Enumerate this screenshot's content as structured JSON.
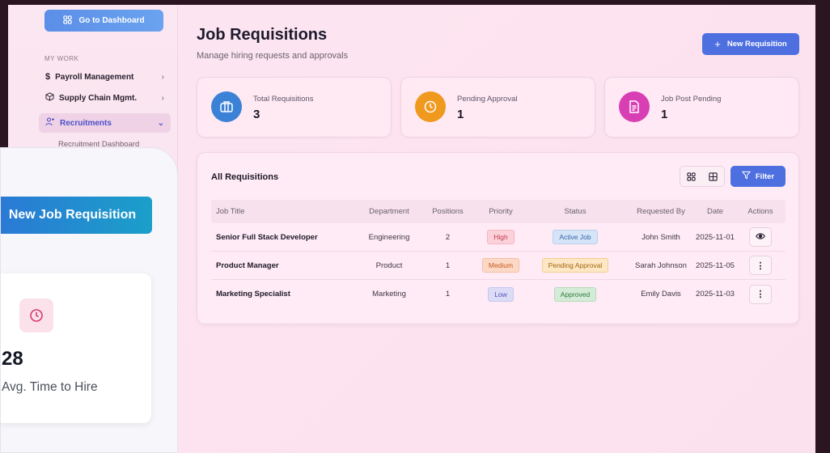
{
  "sidebar": {
    "dashboard_button": "Go to Dashboard",
    "section_label": "MY WORK",
    "items": [
      {
        "label": "Payroll Management",
        "icon": "dollar-icon"
      },
      {
        "label": "Supply Chain Mgmt.",
        "icon": "box-icon"
      },
      {
        "label": "Recruitments",
        "icon": "users-icon"
      }
    ],
    "sub_item": "Recruitment Dashboard"
  },
  "zoom_overlay": {
    "button_label": "New Job Requisition",
    "stat_value": "28",
    "stat_label": "Avg. Time to Hire"
  },
  "header": {
    "title": "Job Requisitions",
    "subtitle": "Manage hiring requests and approvals",
    "new_button": "New Requisition"
  },
  "stats": [
    {
      "label": "Total Requisitions",
      "value": "3",
      "color": "#3b82d6",
      "icon": "briefcase-icon"
    },
    {
      "label": "Pending Approval",
      "value": "1",
      "color": "#f0991f",
      "icon": "clock-icon"
    },
    {
      "label": "Job Post Pending",
      "value": "1",
      "color": "#d93fb4",
      "icon": "document-icon"
    }
  ],
  "table": {
    "title": "All Requisitions",
    "filter_label": "Filter",
    "columns": [
      "Job Title",
      "Department",
      "Positions",
      "Priority",
      "Status",
      "Requested By",
      "Date",
      "Actions"
    ],
    "rows": [
      {
        "title": "Senior Full Stack Developer",
        "department": "Engineering",
        "positions": "2",
        "priority": "High",
        "status": "Active Job",
        "requested_by": "John Smith",
        "date": "2025-11-01",
        "action": "view"
      },
      {
        "title": "Product Manager",
        "department": "Product",
        "positions": "1",
        "priority": "Medium",
        "status": "Pending Approval",
        "requested_by": "Sarah Johnson",
        "date": "2025-11-05",
        "action": "more"
      },
      {
        "title": "Marketing Specialist",
        "department": "Marketing",
        "positions": "1",
        "priority": "Low",
        "status": "Approved",
        "requested_by": "Emily Davis",
        "date": "2025-11-03",
        "action": "more"
      }
    ]
  }
}
